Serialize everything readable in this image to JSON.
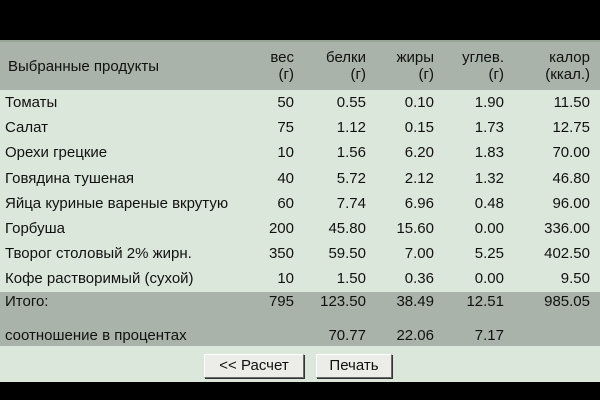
{
  "table": {
    "headers": {
      "name": "Выбранные продукты",
      "weight": {
        "label": "вес",
        "unit": "(г)"
      },
      "protein": {
        "label": "белки",
        "unit": "(г)"
      },
      "fat": {
        "label": "жиры",
        "unit": "(г)"
      },
      "carbs": {
        "label": "углев.",
        "unit": "(г)"
      },
      "kcal": {
        "label": "калор",
        "unit": "(ккал.)"
      }
    },
    "rows": [
      {
        "name": "Томаты",
        "weight": "50",
        "protein": "0.55",
        "fat": "0.10",
        "carbs": "1.90",
        "kcal": "11.50"
      },
      {
        "name": "Салат",
        "weight": "75",
        "protein": "1.12",
        "fat": "0.15",
        "carbs": "1.73",
        "kcal": "12.75"
      },
      {
        "name": "Орехи грецкие",
        "weight": "10",
        "protein": "1.56",
        "fat": "6.20",
        "carbs": "1.83",
        "kcal": "70.00"
      },
      {
        "name": "Говядина тушеная",
        "weight": "40",
        "protein": "5.72",
        "fat": "2.12",
        "carbs": "1.32",
        "kcal": "46.80"
      },
      {
        "name": "Яйца куриные вареные вкрутую",
        "weight": "60",
        "protein": "7.74",
        "fat": "6.96",
        "carbs": "0.48",
        "kcal": "96.00"
      },
      {
        "name": "Горбуша",
        "weight": "200",
        "protein": "45.80",
        "fat": "15.60",
        "carbs": "0.00",
        "kcal": "336.00"
      },
      {
        "name": "Творог столовый 2% жирн.",
        "weight": "350",
        "protein": "59.50",
        "fat": "7.00",
        "carbs": "5.25",
        "kcal": "402.50"
      },
      {
        "name": "Кофе растворимый (сухой)",
        "weight": "10",
        "protein": "1.50",
        "fat": "0.36",
        "carbs": "0.00",
        "kcal": "9.50"
      }
    ],
    "total": {
      "label": "Итого:",
      "weight": "795",
      "protein": "123.50",
      "fat": "38.49",
      "carbs": "12.51",
      "kcal": "985.05"
    },
    "ratio": {
      "label": "соотношение в процентах",
      "protein": "70.77",
      "fat": "22.06",
      "carbs": "7.17"
    }
  },
  "buttons": {
    "calc": "<< Расчет",
    "print": "Печать"
  },
  "colors": {
    "background": "#000000",
    "panel": "#dce7dc",
    "header": "#a9b3a9"
  }
}
